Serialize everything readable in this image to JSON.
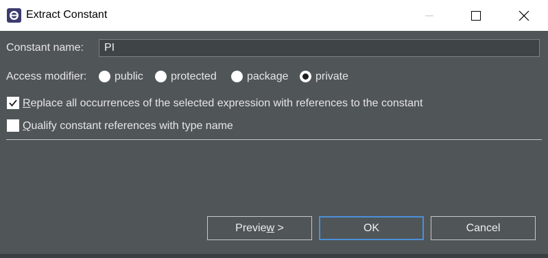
{
  "window": {
    "title": "Extract Constant",
    "controls": {
      "minimize": "minimize-icon",
      "maximize": "maximize-icon",
      "close": "close-icon"
    }
  },
  "form": {
    "constant_name_label": "Constant name:",
    "constant_name_value": "PI",
    "access_modifier_label": "Access modifier:",
    "access_options": [
      {
        "label": "public",
        "selected": false
      },
      {
        "label": "protected",
        "selected": false
      },
      {
        "label": "package",
        "selected": false
      },
      {
        "label": "private",
        "selected": true
      }
    ],
    "replace_all": {
      "label": "Replace all occurrences of the selected expression with references to the constant",
      "checked": true
    },
    "qualify": {
      "label": "Qualify constant references with type name",
      "checked": false
    }
  },
  "buttons": {
    "preview_pre": "Previe",
    "preview_ul": "w",
    "preview_post": " >",
    "ok": "OK",
    "cancel": "Cancel"
  },
  "colors": {
    "background": "#505558",
    "titlebar": "#ffffff",
    "input_bg": "#3f4447",
    "accent": "#4a90d9"
  }
}
